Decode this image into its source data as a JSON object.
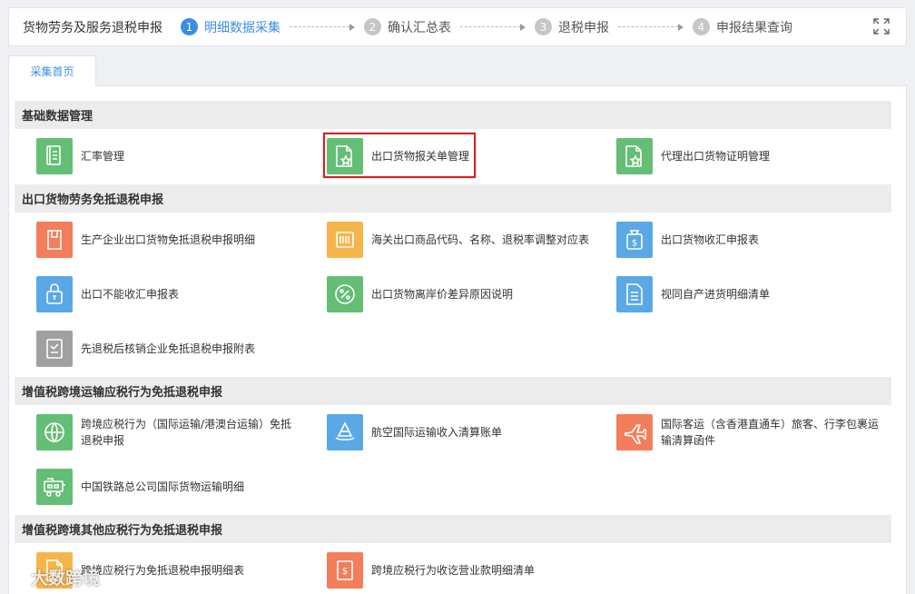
{
  "header": {
    "app_title": "货物劳务及服务退税申报",
    "steps": [
      {
        "num": "1",
        "label": "明细数据采集"
      },
      {
        "num": "2",
        "label": "确认汇总表"
      },
      {
        "num": "3",
        "label": "退税申报"
      },
      {
        "num": "4",
        "label": "申报结果查询"
      }
    ],
    "active_step": 1
  },
  "tabs": [
    {
      "label": "采集首页"
    }
  ],
  "sections": [
    {
      "title": "基础数据管理",
      "items": [
        {
          "label": "汇率管理",
          "icon": "book-icon",
          "color": "#64be75"
        },
        {
          "label": "出口货物报关单管理",
          "icon": "document-star-icon",
          "color": "#64be75"
        },
        {
          "label": "代理出口货物证明管理",
          "icon": "document-star-icon",
          "color": "#64be75"
        }
      ]
    },
    {
      "title": "出口货物劳务免抵退税申报",
      "items": [
        {
          "label": "生产企业出口货物免抵退税申报明细",
          "icon": "file-icon",
          "color": "#f27e5c"
        },
        {
          "label": "海关出口商品代码、名称、退税率调整对应表",
          "icon": "barcode-icon",
          "color": "#f6b54a"
        },
        {
          "label": "出口货物收汇申报表",
          "icon": "dollar-bag-icon",
          "color": "#5aa9e6"
        },
        {
          "label": "出口不能收汇申报表",
          "icon": "lock-bag-icon",
          "color": "#5aa9e6"
        },
        {
          "label": "出口货物离岸价差异原因说明",
          "icon": "percent-icon",
          "color": "#64be75"
        },
        {
          "label": "视同自产进货明细清单",
          "icon": "list-document-icon",
          "color": "#5aa9e6"
        },
        {
          "label": "先退税后核销企业免抵退税申报附表",
          "icon": "clipboard-icon",
          "color": "#a0a0a0"
        }
      ]
    },
    {
      "title": "增值税跨境运输应税行为免抵退税申报",
      "items": [
        {
          "label": "跨境应税行为（国际运输/港澳台运输）免抵退税申报",
          "icon": "globe-icon",
          "color": "#64be75"
        },
        {
          "label": "航空国际运输收入清算账单",
          "icon": "ship-icon",
          "color": "#5aa9e6"
        },
        {
          "label": "国际客运（含香港直通车）旅客、行李包裹运输清算函件",
          "icon": "airplane-icon",
          "color": "#f27e5c"
        },
        {
          "label": "中国铁路总公司国际货物运输明细",
          "icon": "train-icon",
          "color": "#64be75"
        }
      ]
    },
    {
      "title": "增值税跨境其他应税行为免抵退税申报",
      "items": [
        {
          "label": "跨境应税行为免抵退税申报明细表",
          "icon": "document-icon",
          "color": "#f6b54a"
        },
        {
          "label": "跨境应税行为收讫营业款明细清单",
          "icon": "receipt-icon",
          "color": "#f27e5c"
        }
      ]
    }
  ],
  "watermark": "大数跨境",
  "colors": {
    "accent": "#3a8ee6",
    "highlight": "#d61f24"
  }
}
